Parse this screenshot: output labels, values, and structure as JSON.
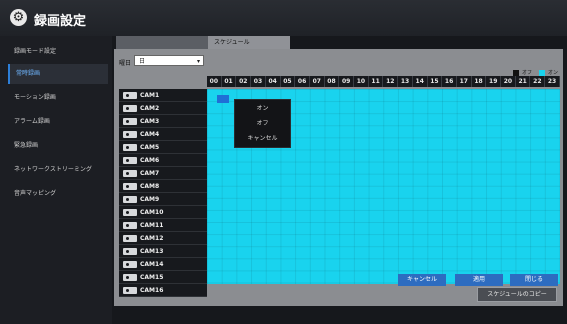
{
  "window": {
    "title": "録画設定"
  },
  "sidebar": {
    "items": [
      {
        "label": "録画モード設定",
        "active": false
      },
      {
        "label": "常時録画",
        "active": true
      },
      {
        "label": "モーション録画",
        "active": false
      },
      {
        "label": "アラーム録画",
        "active": false
      },
      {
        "label": "緊急録画",
        "active": false
      },
      {
        "label": "ネットワークストリーミング",
        "active": false
      },
      {
        "label": "音声マッピング",
        "active": false
      }
    ]
  },
  "tabs": [
    {
      "label": "",
      "active": false
    },
    {
      "label": "スケジュール",
      "active": true
    }
  ],
  "schedule": {
    "day_label": "曜日",
    "day_value": "日",
    "legend": {
      "off_label": "オフ",
      "on_label": "オン",
      "off_color": "#111111",
      "on_color": "#19d3ee"
    },
    "hours": [
      "00",
      "01",
      "02",
      "03",
      "04",
      "05",
      "06",
      "07",
      "08",
      "09",
      "10",
      "11",
      "12",
      "13",
      "14",
      "15",
      "16",
      "17",
      "18",
      "19",
      "20",
      "21",
      "22",
      "23"
    ],
    "cameras": [
      "CAM1",
      "CAM2",
      "CAM3",
      "CAM4",
      "CAM5",
      "CAM6",
      "CAM7",
      "CAM8",
      "CAM9",
      "CAM10",
      "CAM11",
      "CAM12",
      "CAM13",
      "CAM14",
      "CAM15",
      "CAM16"
    ],
    "context_menu": [
      "オン",
      "オフ",
      "キャンセル"
    ],
    "copy_button": "スケジュールのコピー"
  },
  "footer": {
    "cancel_label": "キャンセル",
    "apply_label": "適用",
    "close_label": "閉じる"
  }
}
